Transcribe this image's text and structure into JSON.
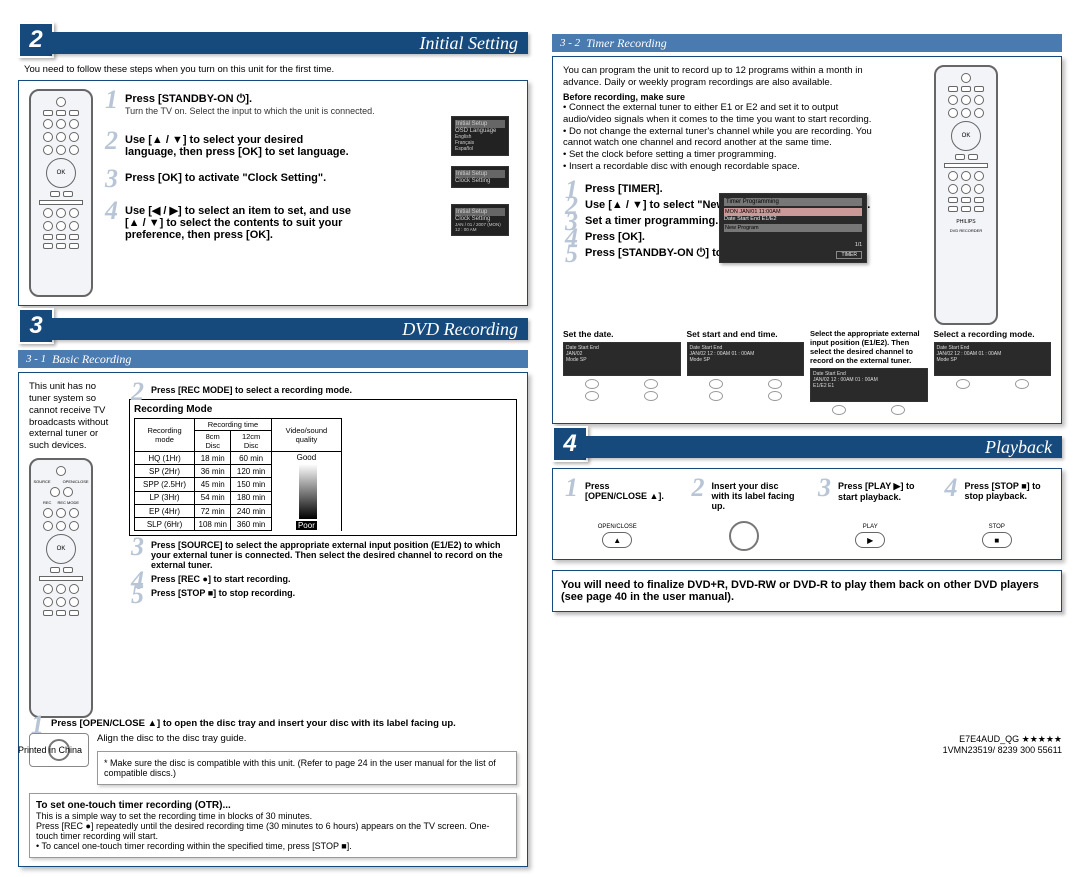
{
  "sections": {
    "initial": {
      "num": "2",
      "title": "Initial Setting"
    },
    "dvd": {
      "num": "3",
      "title": "DVD Recording"
    },
    "playback": {
      "num": "4",
      "title": "Playback"
    }
  },
  "initial_intro": "You need to follow these steps when you turn on this unit for the first time.",
  "initial_steps": {
    "s1": {
      "n": "1",
      "t": "Press [STANDBY-ON ⏻].",
      "b": "Turn the TV on. Select the input to which the unit is connected."
    },
    "s2": {
      "n": "2",
      "t": "Use [▲ / ▼] to select your desired language, then press [OK] to set language."
    },
    "s3": {
      "n": "3",
      "t": "Press [OK] to activate \"Clock Setting\"."
    },
    "s4": {
      "n": "4",
      "t": "Use [◀ / ▶] to select an item to set, and use [▲ / ▼] to select the contents to suit your preference, then press [OK]."
    }
  },
  "basic_sub": {
    "n": "3 - 1",
    "t": "Basic Recording"
  },
  "basic_intro": "This unit has no tuner system so cannot receive TV broadcasts without external tuner or such devices.",
  "basic_steps": {
    "s1": {
      "n": "1",
      "t": "Press [OPEN/CLOSE ▲] to open the disc tray and insert your disc with its label facing up."
    },
    "s1b": "Align the disc to the disc tray guide.",
    "s1c": "* Make sure the disc is compatible with this unit. (Refer to page 24 in the user manual for the list of compatible discs.)",
    "s2": {
      "n": "2",
      "t": "Press [REC MODE] to select a recording mode."
    },
    "s3": {
      "n": "3",
      "t": "Press [SOURCE] to select the appropriate external input position (E1/E2) to which your external tuner is connected. Then select the desired channel to record on the external tuner."
    },
    "s4": {
      "n": "4",
      "t": "Press [REC ●] to start recording."
    },
    "s5": {
      "n": "5",
      "t": "Press [STOP ■] to stop recording."
    }
  },
  "rec_mode_title": "Recording Mode",
  "rec_table": {
    "headers": [
      "Recording mode",
      "Recording time",
      "Video/sound quality"
    ],
    "sub": [
      "8cm Disc",
      "12cm Disc"
    ],
    "rows": [
      [
        "HQ (1Hr)",
        "18 min",
        "60 min"
      ],
      [
        "SP (2Hr)",
        "36 min",
        "120 min"
      ],
      [
        "SPP (2.5Hr)",
        "45 min",
        "150 min"
      ],
      [
        "LP (3Hr)",
        "54 min",
        "180 min"
      ],
      [
        "EP (4Hr)",
        "72 min",
        "240 min"
      ],
      [
        "SLP (6Hr)",
        "108 min",
        "360 min"
      ]
    ],
    "good": "Good",
    "poor": "Poor"
  },
  "otr": {
    "title": "To set one-touch timer recording (OTR)...",
    "b1": "This is a simple way to set the recording time in blocks of 30 minutes.",
    "b2": "Press [REC ●] repeatedly until the desired recording time (30 minutes to 6 hours) appears on the TV screen. One-touch timer recording will start.",
    "b3": "• To cancel one-touch timer recording within the specified time, press [STOP ■]."
  },
  "timer_sub": {
    "n": "3 - 2",
    "t": "Timer Recording"
  },
  "timer_intro": "You can program the unit to record up to 12 programs within a month in advance. Daily or weekly program recordings are also available.",
  "timer_before_t": "Before recording, make sure",
  "timer_before": [
    "• Connect the external tuner to either E1 or E2 and set it to output audio/video signals when it comes to the time you want to start recording.",
    "• Do not change the external tuner's channel while you are recording. You cannot watch one channel and record another at the same time.",
    "• Set the clock before setting a timer programming.",
    "• Insert a recordable disc with enough recordable space."
  ],
  "timer_steps": {
    "s1": {
      "n": "1",
      "t": "Press [TIMER]."
    },
    "s2": {
      "n": "2",
      "t": "Use [▲ / ▼] to select \"New Program\", then press [OK]."
    },
    "s3": {
      "n": "3",
      "t": "Set a timer programming."
    },
    "s4": {
      "n": "4",
      "t": "Press [OK]."
    },
    "s5": {
      "n": "5",
      "t": "Press [STANDBY-ON ⏻] to set a timer programming."
    }
  },
  "timer_cols": {
    "c1": "Set the date.",
    "c2": "Set start and end time.",
    "c3": "Select the appropriate external input position (E1/E2). Then select the desired channel to record on the external tuner.",
    "c4": "Select a recording mode."
  },
  "timer_tv": {
    "title": "Timer Programming",
    "row": "MON  JAN/01 11:00AM",
    "hdr": "Date      Start      End    E1/E2",
    "np": "New Program",
    "pg": "1/1",
    "btn": "TIMER"
  },
  "timer_mini": {
    "hdr": "Date    Start    End",
    "date": "JAN/02",
    "mode": "Mode",
    "sp": "SP",
    "e": "E1/E2",
    "e1": "E1",
    "t1": "12 : 00AM",
    "t2": "01 : 00AM"
  },
  "playback_steps": {
    "s1": {
      "n": "1",
      "t": "Press [OPEN/CLOSE ▲]."
    },
    "s2": {
      "n": "2",
      "t": "Insert your disc with its label facing up."
    },
    "s3": {
      "n": "3",
      "t": "Press [PLAY ▶] to start playback."
    },
    "s4": {
      "n": "4",
      "t": "Press [STOP ■] to stop playback."
    }
  },
  "pb_btn": {
    "open": "OPEN/CLOSE",
    "play": "PLAY",
    "stop": "STOP"
  },
  "playback_note": "You will need to finalize DVD+R, DVD-RW or DVD-R to play them back on other DVD players (see page 40 in the user manual).",
  "remote_ok": "OK",
  "remote_brand": "PHILIPS",
  "remote_model": "DVD RECORDER",
  "clock_labels": {
    "is": "Initial Setup",
    "osd": "OSD Language",
    "cs": "Clock Setting",
    "ex": "JAN / 01 / 2007 (MON)  12 : 00 AM",
    "lang": "English\nFrançais\nEspañol"
  },
  "footer": {
    "l": "Printed in China",
    "r1": "E7E4AUD_QG ★★★★★",
    "r2": "1VMN23519/ 8239 300 55611"
  }
}
